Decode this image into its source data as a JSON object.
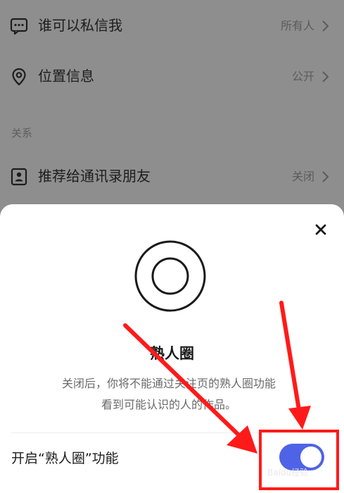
{
  "settings": {
    "items": [
      {
        "label": "谁可以私信我",
        "value": "所有人",
        "icon": "chat-bubble-icon"
      },
      {
        "label": "位置信息",
        "value": "公开",
        "icon": "location-pin-icon"
      },
      {
        "label": "推荐给通讯录朋友",
        "value": "关闭",
        "icon": "contact-card-icon"
      }
    ],
    "section_title": "关系"
  },
  "sheet": {
    "title": "熟人圈",
    "description_line1": "关闭后，你将不能通过关注页的熟人圈功能",
    "description_line2": "看到可能认识的人的作品。",
    "toggle_label": "开启“熟人圈”功能",
    "toggle_on": true
  },
  "watermark": "Baidu经验",
  "colors": {
    "toggle_on": "#4f63e6",
    "highlight": "#ff1a1a",
    "overlay": "#8e8e8e"
  }
}
